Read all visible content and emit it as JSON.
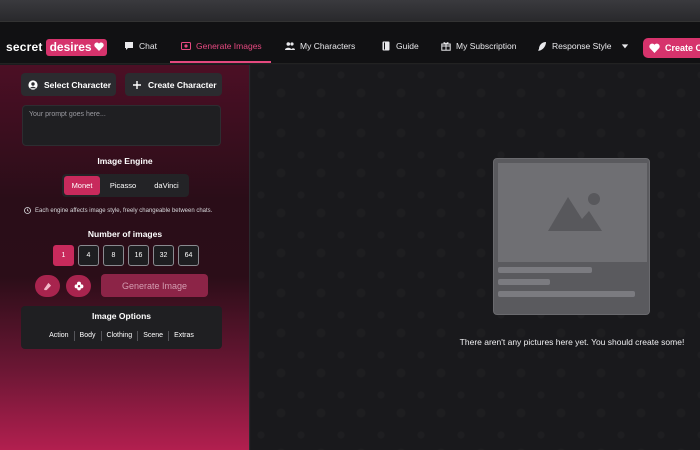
{
  "nav": {
    "logo_word": "secret",
    "logo_pill": "desires",
    "items": [
      {
        "label": "Chat",
        "icon": "chat-bubble-icon"
      },
      {
        "label": "Generate Images",
        "icon": "image-icon",
        "active": true
      },
      {
        "label": "My Characters",
        "icon": "users-icon"
      },
      {
        "label": "Guide",
        "icon": "book-icon"
      },
      {
        "label": "My Subscription",
        "icon": "gift-icon"
      },
      {
        "label": "Response Style",
        "icon": "feather-icon"
      }
    ],
    "create_label": "Create C"
  },
  "sidebar": {
    "select_character": "Select Character",
    "create_character": "Create Character",
    "prompt_placeholder": "Your prompt goes here...",
    "engine_label": "Image Engine",
    "engines": [
      "Monet",
      "Picasso",
      "daVinci"
    ],
    "selected_engine": "Monet",
    "engine_note": "Each engine affects image style, freely changeable between chats.",
    "count_label": "Number of images",
    "counts": [
      "1",
      "4",
      "8",
      "16",
      "32",
      "64"
    ],
    "selected_count": "1",
    "generate_label": "Generate Image",
    "options_title": "Image Options",
    "options": [
      "Action",
      "Body",
      "Clothing",
      "Scene",
      "Extras"
    ]
  },
  "main": {
    "empty_message": "There aren't any pictures here yet. You should create some!"
  },
  "colors": {
    "accent": "#e64980",
    "accent_dark": "#c82a5c",
    "background": "#19191c"
  }
}
